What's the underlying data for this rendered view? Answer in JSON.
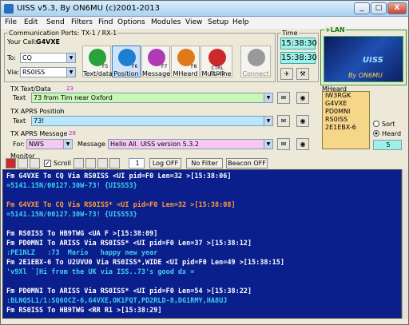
{
  "window": {
    "title": "UISS v5.3, By ON6MU (c)2001-2013",
    "min": "_",
    "max": "□",
    "close": "X"
  },
  "menu": [
    "File",
    "Edit",
    "Send",
    "Filters",
    "Find",
    "Options",
    "Modules",
    "View",
    "Setup",
    "Help"
  ],
  "ports": {
    "title": "Communication Ports: TX-1 / RX-1",
    "callsign_label": "Your Call:",
    "callsign": "G4VXE",
    "to_label": "To:",
    "to_value": "CQ",
    "via_label": "Via:",
    "via_value": "RS0ISS"
  },
  "toolbar": [
    {
      "label": "Text/data",
      "key": "F5",
      "color": "#2aa13a"
    },
    {
      "label": "Position",
      "key": "F6",
      "color": "#1e7fd2"
    },
    {
      "label": "Message",
      "key": "F7",
      "color": "#b03ab6"
    },
    {
      "label": "MHeard",
      "key": "F8",
      "color": "#e07a18"
    },
    {
      "label": "Multi-line",
      "key": "CTRL F1/2/3",
      "color": "#cc2a2a"
    },
    {
      "label": "Connect",
      "key": "",
      "color": "#999999"
    }
  ],
  "time": {
    "title": "Time",
    "utc": "15:38:30",
    "local": "15:38:30"
  },
  "lan": {
    "title": "+LAN",
    "logo_text": "UISS",
    "logo_sub": "By ON6MU"
  },
  "tx_text": {
    "title": "TX Text/Data",
    "label": "Text",
    "value": "73 from Tim near Oxford",
    "count": "23"
  },
  "tx_position": {
    "title": "TX APRS Position",
    "label": "Text",
    "value": "73!",
    "count": "3"
  },
  "tx_message": {
    "title": "TX APRS Message",
    "count": "28",
    "for_label": "For:",
    "for_value": "NWS",
    "message_label": "Message",
    "message_value": "Hello All. UISS version 5.3.2"
  },
  "mheard": {
    "title": "MHeard",
    "items": [
      "IW3RGK",
      "G4VXE",
      "PD0MNI",
      "RS0ISS",
      "2E1EBX-6"
    ],
    "sort_label": "Sort",
    "heard_label": "Heard",
    "count": "5"
  },
  "monitor_bar": {
    "title": "Monitor",
    "scroll_label": "Scroll",
    "page": "1",
    "log": "Log OFF",
    "filter": "No Filter",
    "beacon": "Beacon OFF"
  },
  "monitor_lines": [
    {
      "text": "Fm G4VXE To CQ Via RS0ISS <UI pid=F0 Len=32 >[15:38:06]",
      "color": "#ffffff"
    },
    {
      "text": "=5141.15N/00127.30W-73! {UISS53}",
      "color": "#40d0f0"
    },
    {
      "text": "",
      "color": "#ffffff"
    },
    {
      "text": "Fm G4VXE To CQ Via RS0ISS* <UI pid=F0 Len=32 >[15:38:08]",
      "color": "#ff9a3a"
    },
    {
      "text": "=5141.15N/00127.30W-73! {UISS53}",
      "color": "#40d0f0"
    },
    {
      "text": "",
      "color": "#ffffff"
    },
    {
      "text": "Fm RS0ISS To HB9TWG <UA F >[15:38:09]",
      "color": "#ffffff"
    },
    {
      "text": "Fm PD0MNI To ARISS Via RS0ISS* <UI pid=F0 Len=37 >[15:38:12]",
      "color": "#ffffff"
    },
    {
      "text": ":PE1NLZ   :73  Mario   happy new year",
      "color": "#40d0f0"
    },
    {
      "text": "Fm 2E1EBX-6 To U2UVU0 Via RS0ISS*,WIDE <UI pid=F0 Len=49 >[15:38:15]",
      "color": "#ffffff"
    },
    {
      "text": "'v9Xl `]Hi from the UK via ISS..73's good dx =",
      "color": "#40d0f0"
    },
    {
      "text": "",
      "color": "#ffffff"
    },
    {
      "text": "Fm PD0MNI To ARISS Via RS0ISS* <UI pid=F0 Len=54 >[15:38:22]",
      "color": "#ffffff"
    },
    {
      "text": ":BLNQSL1/1:SQ6OCZ-6,G4VXE,OK1FQT,PD2RLD-8,DG1RMY,HA8UJ",
      "color": "#40d0f0"
    },
    {
      "text": "Fm RS0ISS To HB9TWG <RR R1 >[15:38:29]",
      "color": "#ffffff"
    }
  ]
}
